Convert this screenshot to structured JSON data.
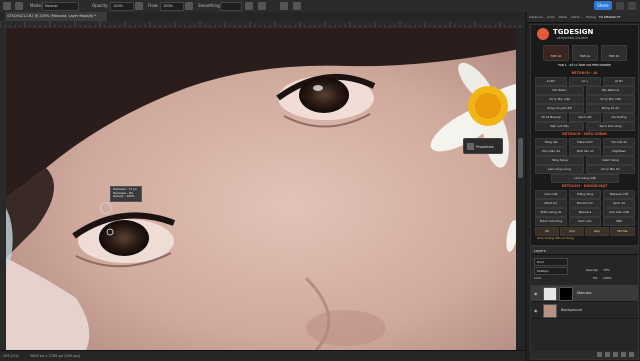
{
  "menubar": {
    "mode_label": "Mode:",
    "mode_value": "Normal",
    "opacity_label": "Opacity:",
    "opacity_value": "100%",
    "flow_label": "Flow:",
    "flow_value": "100%",
    "smoothing_label": "Smoothing:",
    "share_label": "Share"
  },
  "document": {
    "tab_title": "GTSC9421.CR2 @ 205% (Manusia, Layer Mask/8) *"
  },
  "status": {
    "zoom": "205,21%",
    "doc_info": "3840 px x 2785 px (300 ppi)"
  },
  "right_tabs": [
    "Adobe Cl...",
    "Color",
    "Paths",
    "Librar...",
    "Histog",
    "TG DESIGN V7"
  ],
  "plugin": {
    "brand": "TGDESIGN",
    "brand_sub": "RETOUCHING ACADEMY",
    "tabs": [
      "TAB 1A",
      "TAB 2A",
      "TAB 3A"
    ],
    "version_title": "TAB 1 - KỸ LÝ ẢNH CHUYÊN NGHIỆP",
    "section1": "RETOUCH - AI",
    "ai_row": [
      "AI Pro",
      "AI +",
      "AI Fix"
    ],
    "ai_buttons": [
      [
        "Mịn Basic",
        "Mịn Natural"
      ],
      [
        "Xử lý Mọi mặt",
        "Xử lý Mọi mắt"
      ],
      [
        "Vùng chuyển đổi",
        "Đồng bộ da"
      ],
      [
        "Tổ sổ Beauty",
        "Sạch nốt",
        "Da Dưỡng"
      ],
      [
        "Nền 1/2 Mịn",
        "Sạch ánh sáng"
      ]
    ],
    "section2": "RETOUCH - ĐIỀU CHỈNH",
    "adjust_buttons": [
      [
        "Tăng nét",
        "Đánh khối",
        "Tạo hột da"
      ],
      [
        "Phủ màu da",
        "Tách tần số",
        "HighPass"
      ],
      [
        "Tăng Sáng",
        "",
        "Giảm Sáng"
      ],
      [
        "Làm sáng vùng",
        "",
        "Xử lý Mịn bỏ"
      ]
    ],
    "light_label": "Làm sáng mắt",
    "section3": "RETOUCH - KHUÔN MẶT",
    "face_buttons": [
      [
        "Gọn mặt",
        "Trắng răng",
        "Makeup mắt"
      ],
      [
        "Mượt tóc",
        "Nhuộm tóc",
        "Sạch da"
      ],
      [
        "Điểm sáng da",
        "Mascara",
        "Xóa viền mắt"
      ],
      [
        "Đánh má hồng",
        "Kem nền",
        "Mắt"
      ]
    ],
    "bottom_buttons": [
      "OK",
      "Xóa",
      "Gộp",
      "Mở file"
    ],
    "footer_link": "Xem hướng dẫn sử dụng"
  },
  "layers": {
    "title": "Layers",
    "kind_label": "Kind",
    "blend_value": "Multiply",
    "opacity_label": "Opacity:",
    "opacity_value": "70%",
    "fill_label": "Fill:",
    "fill_value": "100%",
    "lock_label": "Lock:",
    "items": [
      {
        "name": "Manusia"
      },
      {
        "name": "Background"
      }
    ]
  },
  "properties_label": "Properties",
  "brush_tooltip": {
    "diameter": "Diameter : 17 px",
    "hardness": "Hardness :  0%",
    "opacity": "Opacity :  100%"
  },
  "colors": {
    "accent": "#2f79d6",
    "brand_red": "#e25a3a"
  }
}
